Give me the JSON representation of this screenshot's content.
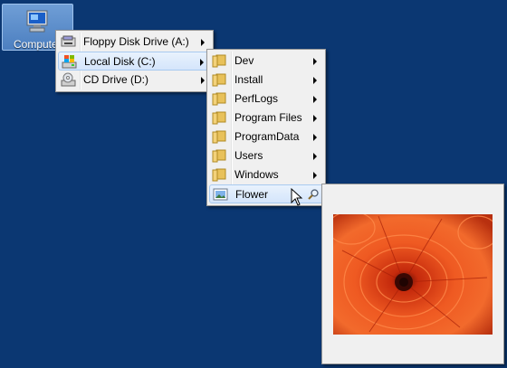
{
  "desktop": {
    "computer_label": "Compute"
  },
  "menu1": {
    "items": [
      {
        "label": "Floppy Disk Drive (A:)",
        "icon": "floppy-drive-icon"
      },
      {
        "label": "Local Disk (C:)",
        "icon": "local-disk-icon"
      },
      {
        "label": "CD Drive (D:)",
        "icon": "cd-drive-icon"
      }
    ]
  },
  "menu2": {
    "items": [
      {
        "label": "Dev",
        "icon": "folder-icon"
      },
      {
        "label": "Install",
        "icon": "folder-icon"
      },
      {
        "label": "PerfLogs",
        "icon": "folder-icon"
      },
      {
        "label": "Program Files",
        "icon": "folder-icon"
      },
      {
        "label": "ProgramData",
        "icon": "folder-icon"
      },
      {
        "label": "Users",
        "icon": "folder-icon"
      },
      {
        "label": "Windows",
        "icon": "folder-icon"
      },
      {
        "label": "Flower",
        "icon": "image-file-icon"
      }
    ]
  },
  "preview": {
    "image": "flower-preview-image"
  },
  "colors": {
    "desktop": "#0b3772",
    "menu_bg": "#f0f0f0",
    "highlight": "#d4e5fb",
    "flower": "#e8451c"
  }
}
